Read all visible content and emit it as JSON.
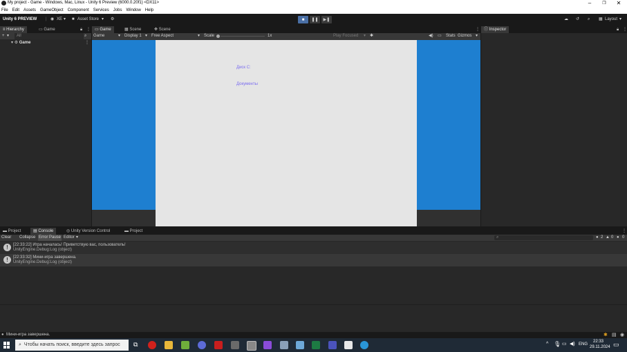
{
  "window": {
    "title": "My project - Game - Windows, Mac, Linux - Unity 6 Preview (6000.0.20f1) <DX11>",
    "controls": [
      "–",
      "❐",
      "✕"
    ]
  },
  "menu": [
    "File",
    "Edit",
    "Assets",
    "GameObject",
    "Component",
    "Services",
    "Jobs",
    "Window",
    "Help"
  ],
  "toolbar": {
    "brand": "Unity 6 PREVIEW",
    "account": "XE",
    "asset_store": "Asset Store",
    "layout": "Layout"
  },
  "hierarchy": {
    "tabs": [
      "Hierarchy",
      "Game"
    ],
    "add_label": "+",
    "search_placeholder": "All",
    "root": "Game"
  },
  "center": {
    "tabs": [
      "Game",
      "Scene",
      "Scene"
    ],
    "game_bar": {
      "mode": "Game",
      "display": "Display 1",
      "aspect": "Free Aspect",
      "scale_label": "Scale",
      "scale_value": "1x",
      "play_focused": "Play Focused",
      "stats": "Stats",
      "gizmos": "Gizmos"
    },
    "game_texts": [
      "Диск С:",
      "Документы"
    ]
  },
  "inspector": {
    "tab": "Inspector"
  },
  "bottom": {
    "tabs": [
      "Project",
      "Console",
      "Unity Version Control",
      "Project"
    ],
    "console_bar": {
      "clear": "Clear",
      "collapse": "Collapse",
      "error_pause": "Error Pause",
      "editor": "Editor",
      "count_log": "2",
      "count_warn": "0",
      "count_err": "0"
    },
    "logs": [
      {
        "line1": "[22:33:22] Игра началась! Приветствую вас, пользователь!",
        "line2": "UnityEngine.Debug:Log (object)"
      },
      {
        "line1": "[22:33:32] Мини-игра завершена.",
        "line2": "UnityEngine.Debug:Log (object)"
      }
    ]
  },
  "status": {
    "message": "Мини-игра завершена."
  },
  "taskbar": {
    "search_placeholder": "Чтобы начать поиск, введите здесь запрос",
    "lang": "ENG",
    "time": "22:33",
    "date": "29.11.2024"
  },
  "colors": {
    "game_bg": "#1e7fd0",
    "canvas": "#e5e5e5",
    "game_text": "#7a6cf0",
    "panel": "#282828"
  }
}
